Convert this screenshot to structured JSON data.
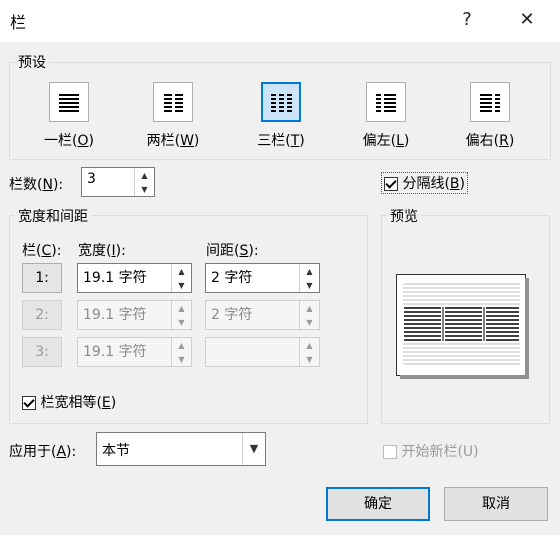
{
  "window": {
    "title": "栏",
    "help_label": "?",
    "close_label": "✕"
  },
  "presets": {
    "group_label": "预设",
    "items": [
      {
        "label": "一栏(",
        "key": "O",
        "suffix": ")"
      },
      {
        "label": "两栏(",
        "key": "W",
        "suffix": ")"
      },
      {
        "label": "三栏(",
        "key": "T",
        "suffix": ")"
      },
      {
        "label": "偏左(",
        "key": "L",
        "suffix": ")"
      },
      {
        "label": "偏右(",
        "key": "R",
        "suffix": ")"
      }
    ],
    "selected": "三栏(T)"
  },
  "columns_count": {
    "label": "栏数(",
    "key": "N",
    "suffix": "):",
    "value": "3"
  },
  "separator": {
    "label": "分隔线(",
    "key": "B",
    "suffix": ")",
    "checked": true
  },
  "width_spacing": {
    "group_label": "宽度和间距",
    "col_header": {
      "label": "栏(",
      "key": "C",
      "suffix": "):"
    },
    "width_header": {
      "label": "宽度(",
      "key": "I",
      "suffix": "):"
    },
    "spacing_header": {
      "label": "间距(",
      "key": "S",
      "suffix": "):"
    },
    "rows": [
      {
        "num": "1:",
        "width": "19.1 字符",
        "spacing": "2 字符"
      },
      {
        "num": "2:",
        "width": "19.1 字符",
        "spacing": "2 字符"
      },
      {
        "num": "3:",
        "width": "19.1 字符",
        "spacing": ""
      }
    ],
    "equal_width": {
      "label": "栏宽相等(",
      "key": "E",
      "suffix": ")",
      "checked": true
    }
  },
  "preview": {
    "group_label": "预览"
  },
  "apply_to": {
    "label": "应用于(",
    "key": "A",
    "suffix": "):",
    "value": "本节"
  },
  "new_column": {
    "label": "开始新栏(U)",
    "checked": false
  },
  "buttons": {
    "ok": "确定",
    "cancel": "取消"
  }
}
